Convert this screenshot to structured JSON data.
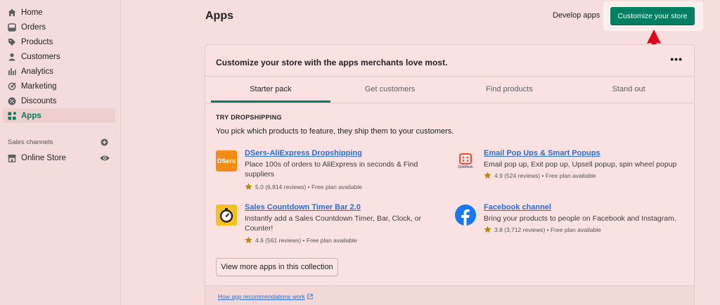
{
  "sidebar": {
    "items": [
      {
        "label": "Home",
        "icon": "home-icon"
      },
      {
        "label": "Orders",
        "icon": "orders-icon"
      },
      {
        "label": "Products",
        "icon": "tag-icon"
      },
      {
        "label": "Customers",
        "icon": "person-icon"
      },
      {
        "label": "Analytics",
        "icon": "bar-chart-icon"
      },
      {
        "label": "Marketing",
        "icon": "target-icon"
      },
      {
        "label": "Discounts",
        "icon": "discount-icon"
      },
      {
        "label": "Apps",
        "icon": "apps-icon",
        "active": true
      }
    ],
    "sales_channels_label": "Sales channels",
    "channels": [
      {
        "label": "Online Store",
        "icon": "store-icon"
      }
    ]
  },
  "header": {
    "title": "Apps",
    "develop_apps": "Develop apps",
    "customize_button": "Customize your store"
  },
  "card": {
    "title": "Customize your store with the apps merchants love most.",
    "more_label": "•••",
    "tabs": [
      {
        "label": "Starter pack",
        "active": true
      },
      {
        "label": "Get customers"
      },
      {
        "label": "Find products"
      },
      {
        "label": "Stand out"
      }
    ],
    "collection_title": "TRY DROPSHIPPING",
    "collection_desc": "You pick which products to feature, they ship them to your customers.",
    "apps": [
      {
        "name": "DSers-AliExpress Dropshipping",
        "icon_text": "DSers",
        "description": "Place 100s of orders to AliExpress in seconds & Find suppliers",
        "rating": "5.0 (6,814 reviews) • Free plan available"
      },
      {
        "name": "Email Pop Ups & Smart Popups",
        "icon_text": "OptiMonk",
        "description": "Email pop up, Exit pop up, Upsell popup, spin wheel popup",
        "rating": "4.9 (524 reviews) • Free plan available"
      },
      {
        "name": "Sales Countdown Timer Bar 2.0",
        "description": "Instantly add a Sales Countdown Timer, Bar, Clock, or Counter!",
        "rating": "4.6 (561 reviews) • Free plan available"
      },
      {
        "name": "Facebook channel",
        "description": "Bring your products to people on Facebook and Instagram.",
        "rating": "3.8 (3,712 reviews) • Free plan available"
      }
    ],
    "view_more": "View more apps in this collection",
    "footer_link": "How app recommendations work"
  },
  "colors": {
    "accent": "#008060",
    "link": "#2c6ecb",
    "arrow": "#e0001a",
    "background": "#f6dede"
  }
}
